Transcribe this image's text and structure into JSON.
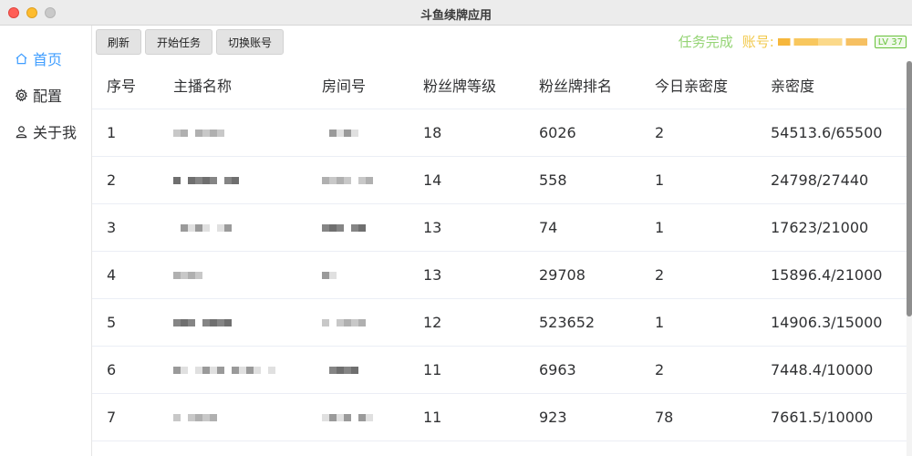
{
  "window": {
    "title": "斗鱼续牌应用"
  },
  "sidebar": {
    "items": [
      {
        "label": "首页",
        "icon": "home-icon",
        "active": true
      },
      {
        "label": "配置",
        "icon": "gear-icon",
        "active": false
      },
      {
        "label": "关于我",
        "icon": "user-icon",
        "active": false
      }
    ]
  },
  "toolbar": {
    "refresh_label": "刷新",
    "start_label": "开始任务",
    "switch_label": "切换账号"
  },
  "status": {
    "task_status": "任务完成",
    "account_label": "账号:",
    "level": "LV 37"
  },
  "colors": {
    "accent": "#409eff",
    "task_status": "#95d475",
    "account": "#f2c94c",
    "level_badge": "#67c23a"
  },
  "table": {
    "headers": [
      "序号",
      "主播名称",
      "房间号",
      "粉丝牌等级",
      "粉丝牌排名",
      "今日亲密度",
      "亲密度"
    ],
    "rows": [
      {
        "index": "1",
        "level": "18",
        "rank": "6026",
        "today": "2",
        "intimacy": "54513.6/65500"
      },
      {
        "index": "2",
        "level": "14",
        "rank": "558",
        "today": "1",
        "intimacy": "24798/27440"
      },
      {
        "index": "3",
        "level": "13",
        "rank": "74",
        "today": "1",
        "intimacy": "17623/21000"
      },
      {
        "index": "4",
        "level": "13",
        "rank": "29708",
        "today": "2",
        "intimacy": "15896.4/21000"
      },
      {
        "index": "5",
        "level": "12",
        "rank": "523652",
        "today": "1",
        "intimacy": "14906.3/15000"
      },
      {
        "index": "6",
        "level": "11",
        "rank": "6963",
        "today": "2",
        "intimacy": "7448.4/10000"
      },
      {
        "index": "7",
        "level": "11",
        "rank": "923",
        "today": "78",
        "intimacy": "7661.5/10000"
      }
    ]
  }
}
